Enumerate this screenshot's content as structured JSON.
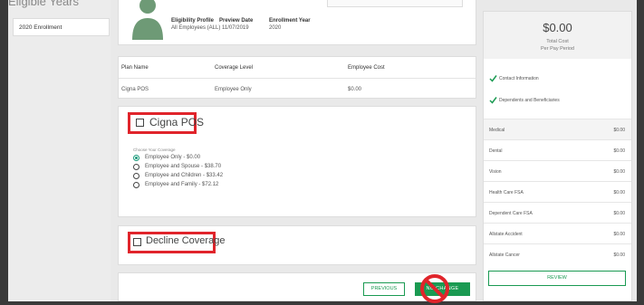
{
  "left_nav": {
    "section_title": "Eligible Years",
    "items": [
      {
        "label": "2020 Enrollment"
      }
    ]
  },
  "profile": {
    "eligibility_label": "Eligibility Profile",
    "eligibility_value": "All Employees (ALL)",
    "preview_label": "Preview Date",
    "preview_value": "11/07/2019",
    "year_label": "Enrollment Year",
    "year_value": "2020"
  },
  "plan_table": {
    "headers": [
      "Plan Name",
      "Coverage Level",
      "Employee Cost"
    ],
    "rows": [
      [
        "Cigna POS",
        "Employee Only",
        "$0.00"
      ]
    ]
  },
  "plan_option": {
    "title": "Cigna POS",
    "choose_label": "Choose Your Coverage",
    "options": [
      {
        "label": "Employee Only - $0.00",
        "selected": true
      },
      {
        "label": "Employee and Spouse - $38.70",
        "selected": false
      },
      {
        "label": "Employee and Children - $33.42",
        "selected": false
      },
      {
        "label": "Employee and Family - $72.12",
        "selected": false
      }
    ]
  },
  "decline": {
    "title": "Decline Coverage"
  },
  "buttons": {
    "previous": "PREVIOUS",
    "next": "NO CHANGE"
  },
  "summary": {
    "total": "$0.00",
    "total_label": "Total Cost",
    "period_label": "Per Pay Period",
    "checks": [
      {
        "label": "Contact Information"
      },
      {
        "label": "Dependents and Beneficiaries"
      }
    ],
    "benefits": [
      {
        "name": "Medical",
        "cost": "$0.00"
      },
      {
        "name": "Dental",
        "cost": "$0.00"
      },
      {
        "name": "Vision",
        "cost": "$0.00"
      },
      {
        "name": "Health Care FSA",
        "cost": "$0.00"
      },
      {
        "name": "Dependent Care FSA",
        "cost": "$0.00"
      },
      {
        "name": "Allstate Accident",
        "cost": "$0.00"
      },
      {
        "name": "Allstate Cancer",
        "cost": "$0.00"
      }
    ],
    "review": "REVIEW"
  },
  "colors": {
    "accent_green": "#1a9a52",
    "radio_teal": "#1a9a7a",
    "highlight_red": "#e0242b"
  },
  "icons": {
    "avatar": "person-silhouette-icon",
    "check": "green-checkmark-icon",
    "prohibited": "no-sign-icon"
  }
}
